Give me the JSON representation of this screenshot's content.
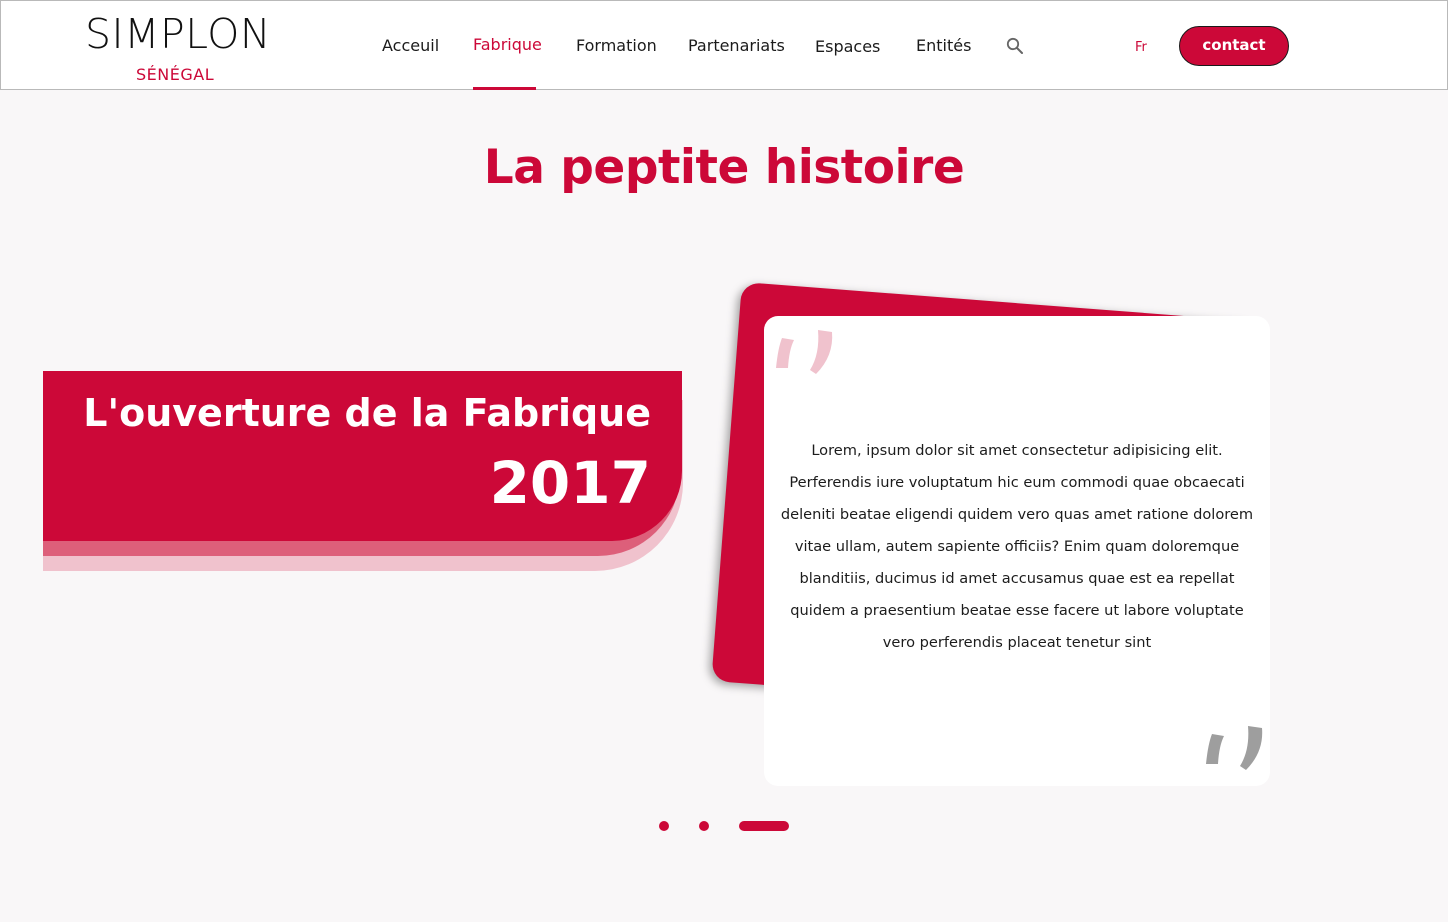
{
  "colors": {
    "brand": "#cc0838",
    "brand_light": "#f0c2cd",
    "brand_mid": "#dd5f7a",
    "quote_mark_light": "#f0c2cd",
    "quote_mark_gray": "#9e9e9e",
    "page_bg": "#f9f7f8"
  },
  "header": {
    "logo": {
      "word": "SIMPLON",
      "sub": "SÉNÉGAL"
    },
    "nav": [
      {
        "label": "Acceuil",
        "active": false
      },
      {
        "label": "Fabrique",
        "active": true
      },
      {
        "label": "Formation",
        "active": false
      },
      {
        "label": "Partenariats",
        "active": false
      },
      {
        "label": "Espaces",
        "active": false
      },
      {
        "label": "Entités",
        "active": false
      }
    ],
    "search_icon": "search-icon",
    "language": "Fr",
    "contact_label": "contact"
  },
  "main": {
    "title": "La peptite histoire",
    "event": {
      "title": "L'ouverture de la Fabrique",
      "year": "2017"
    },
    "quote": {
      "open_icon": "quote-open-icon",
      "close_icon": "quote-close-icon",
      "text": "Lorem, ipsum dolor sit amet consectetur adipisicing elit. Perferendis iure voluptatum hic eum commodi quae obcaecati deleniti beatae eligendi quidem vero quas amet ratione dolorem vitae ullam, autem sapiente officiis? Enim quam doloremque blanditiis, ducimus id amet accusamus quae est ea repellat quidem a praesentium beatae esse facere ut labore voluptate vero perferendis placeat tenetur sint"
    },
    "carousel": {
      "slides": 3,
      "active_index": 2
    }
  }
}
